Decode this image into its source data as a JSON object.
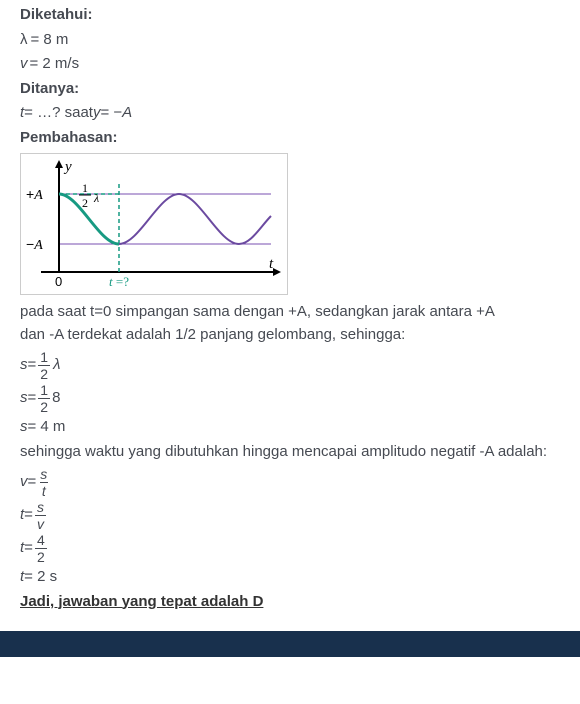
{
  "headings": {
    "diketahui": "Diketahui:",
    "ditanya": "Ditanya:",
    "pembahasan": "Pembahasan:"
  },
  "given": {
    "lambda_sym": "λ",
    "lambda_val": "= 8 m",
    "v_sym": "v",
    "v_val": "= 2 m/s"
  },
  "asked": {
    "t_prefix": "t",
    "t_text": " = …? saat ",
    "y_sym": "y",
    "y_rhs": " = − ",
    "A_sym": "A"
  },
  "para1_a": "pada saat t=0 simpangan sama dengan +A, sedangkan jarak antara +A",
  "para1_b": "dan -A terdekat adalah 1/2 panjang gelombang, sehingga:",
  "step_s1": {
    "lhs": "s",
    "eq": " = ",
    "num": "1",
    "den": "2",
    "tail": "λ"
  },
  "step_s2": {
    "lhs": "s",
    "eq": " = ",
    "num": "1",
    "den": "2",
    "tail": "8"
  },
  "step_s3": {
    "lhs": "s",
    "eq": " = 4 m"
  },
  "para2": "sehingga waktu yang dibutuhkan hingga mencapai amplitudo negatif -A adalah:",
  "step_v": {
    "lhs": "v",
    "eq": " = ",
    "num": "s",
    "den": "t"
  },
  "step_t1": {
    "lhs": "t",
    "eq": " = ",
    "num": "s",
    "den": "v"
  },
  "step_t2": {
    "lhs": "t",
    "eq": " = ",
    "num": "4",
    "den": "2"
  },
  "step_t3": {
    "lhs": "t",
    "eq": " = 2 s"
  },
  "conclusion": "Jadi, jawaban yang tepat adalah D",
  "chart_data": {
    "type": "line",
    "title": "",
    "xlabel": "t",
    "ylabel": "y",
    "y_ticks": [
      "+A",
      "−A"
    ],
    "x_ticks": [
      "0",
      "t =?"
    ],
    "annotation": "½ λ",
    "series": [
      {
        "name": "wave",
        "description": "cosine-like wave starting at +A, going to −A at t=?, continuing two periods"
      },
      {
        "name": "highlight",
        "description": "first quarter from +A to −A shown in green with dashed guides"
      }
    ]
  }
}
